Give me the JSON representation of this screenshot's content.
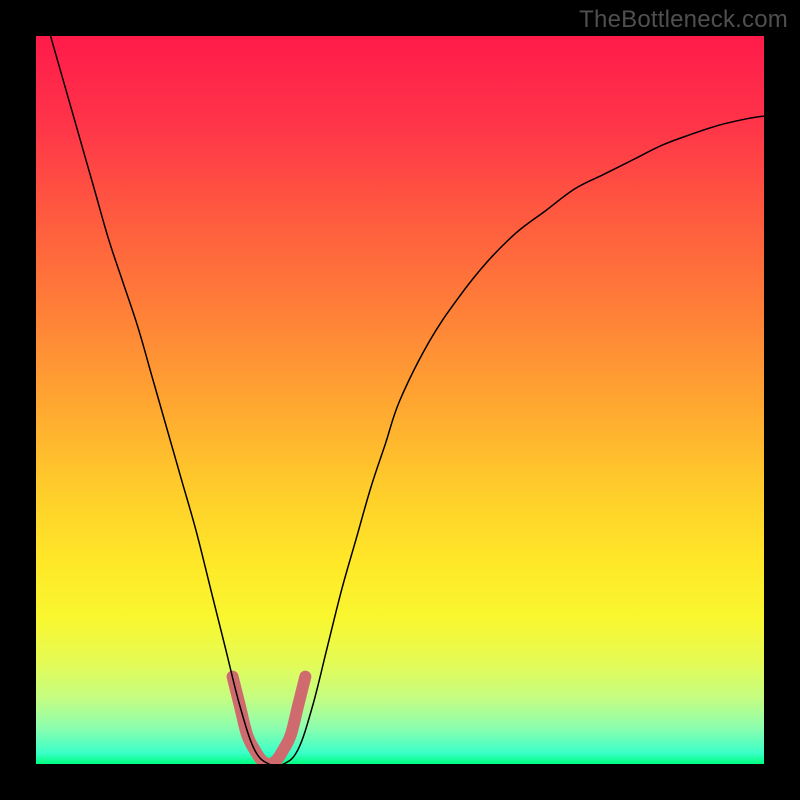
{
  "watermark": "TheBottleneck.com",
  "chart_data": {
    "type": "line",
    "title": "",
    "xlabel": "",
    "ylabel": "",
    "xlim": [
      0,
      100
    ],
    "ylim": [
      0,
      100
    ],
    "grid": false,
    "series": [
      {
        "name": "curve",
        "stroke": "#000000",
        "stroke_width": 1.5,
        "x": [
          2,
          4,
          6,
          8,
          10,
          12,
          14,
          16,
          18,
          20,
          22,
          24,
          26,
          28,
          30,
          32,
          34,
          36,
          38,
          40,
          42,
          44,
          46,
          48,
          50,
          54,
          58,
          62,
          66,
          70,
          74,
          78,
          82,
          86,
          90,
          94,
          98,
          100
        ],
        "values": [
          100,
          93,
          86,
          79,
          72,
          66,
          60,
          53,
          46,
          39,
          32,
          24,
          16,
          8,
          2,
          0,
          0,
          2,
          8,
          16,
          24,
          31,
          38,
          44,
          50,
          58,
          64,
          69,
          73,
          76,
          79,
          81,
          83,
          85,
          86.5,
          87.8,
          88.7,
          89
        ]
      },
      {
        "name": "highlight",
        "stroke": "#cf6a6f",
        "stroke_width": 12,
        "linecap": "round",
        "x": [
          27,
          28,
          29,
          30,
          31,
          32,
          33,
          34,
          35,
          36,
          37
        ],
        "values": [
          12,
          8,
          4,
          2,
          0.5,
          0,
          0.5,
          2,
          4,
          8,
          12
        ]
      }
    ],
    "background_gradient": {
      "type": "linear-vertical",
      "stops": [
        {
          "offset": 0.0,
          "color": "#ff1b4a"
        },
        {
          "offset": 0.12,
          "color": "#ff3449"
        },
        {
          "offset": 0.25,
          "color": "#ff5b3f"
        },
        {
          "offset": 0.38,
          "color": "#ff8038"
        },
        {
          "offset": 0.5,
          "color": "#ffa531"
        },
        {
          "offset": 0.62,
          "color": "#ffcc2b"
        },
        {
          "offset": 0.72,
          "color": "#ffe728"
        },
        {
          "offset": 0.8,
          "color": "#f9f72f"
        },
        {
          "offset": 0.86,
          "color": "#e5fb55"
        },
        {
          "offset": 0.91,
          "color": "#c4fd82"
        },
        {
          "offset": 0.95,
          "color": "#8dfeae"
        },
        {
          "offset": 0.985,
          "color": "#3affc8"
        },
        {
          "offset": 1.0,
          "color": "#00ff7e"
        }
      ]
    }
  }
}
